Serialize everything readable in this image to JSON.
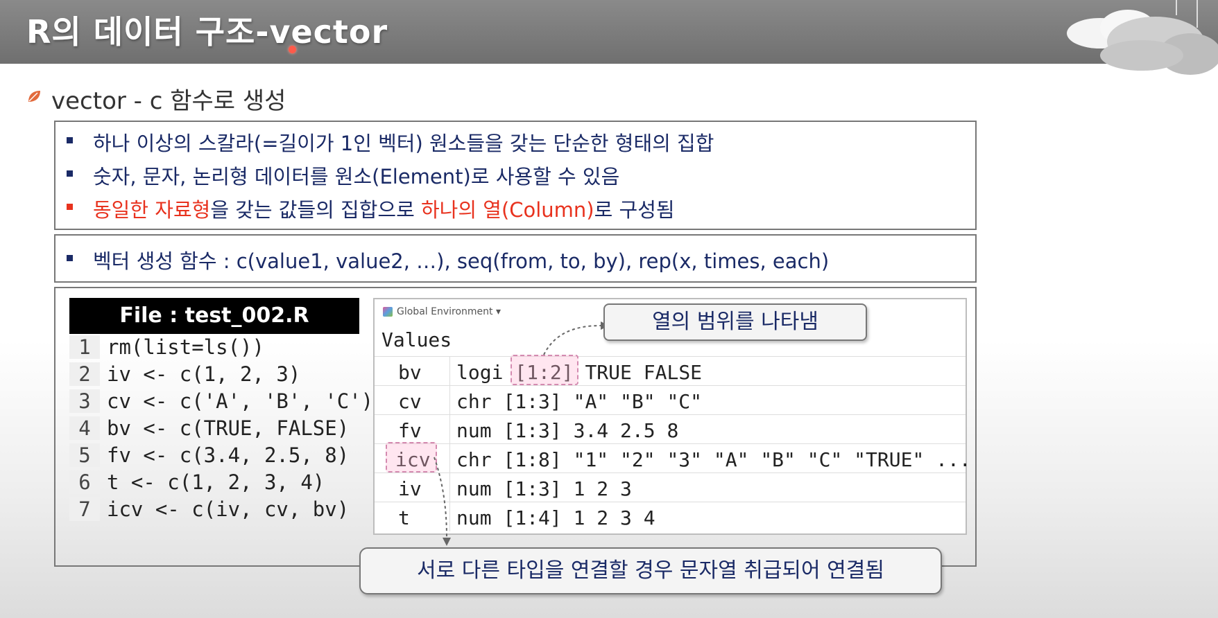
{
  "slide": {
    "title": "R의 데이터 구조-vector",
    "subtitle": "vector - c 함수로 생성"
  },
  "box1": {
    "bullets": [
      {
        "text": "하나 이상의 스칼라(=길이가 1인 벡터) 원소들을 갖는 단순한 형태의 집합"
      },
      {
        "text": "숫자, 문자, 논리형 데이터를 원소(Element)로 사용할 수 있음"
      },
      {
        "parts": [
          "동일한 자료형",
          "을 갖는 값들의 집합으로 ",
          "하나의 열(Column)",
          "로 구성됨"
        ]
      }
    ]
  },
  "box2": {
    "bullet": "벡터 생성 함수 : c(value1, value2, …), seq(from, to, by), rep(x, times, each)"
  },
  "file": {
    "header": "File : test_002.R",
    "lines": [
      {
        "n": "1",
        "code": "rm(list=ls())"
      },
      {
        "n": "2",
        "code": "iv <- c(1, 2, 3)"
      },
      {
        "n": "3",
        "code": "cv <- c('A', 'B', 'C')"
      },
      {
        "n": "4",
        "code": "bv <- c(TRUE, FALSE)"
      },
      {
        "n": "5",
        "code": "fv <- c(3.4, 2.5, 8)"
      },
      {
        "n": "6",
        "code": "t <- c(1, 2, 3, 4)"
      },
      {
        "n": "7",
        "code": "icv <- c(iv, cv, bv)"
      }
    ]
  },
  "environment": {
    "dropdown": "Global Environment",
    "section": "Values",
    "rows": [
      {
        "name": "bv",
        "type": "logi",
        "range": "[1:2]",
        "values": "TRUE FALSE"
      },
      {
        "name": "cv",
        "type": "chr",
        "range": "[1:3]",
        "values": "\"A\" \"B\" \"C\""
      },
      {
        "name": "fv",
        "type": "num",
        "range": "[1:3]",
        "values": "3.4 2.5 8"
      },
      {
        "name": "icv",
        "type": "chr",
        "range": "[1:8]",
        "values": "\"1\" \"2\" \"3\" \"A\" \"B\" \"C\" \"TRUE\" ..."
      },
      {
        "name": "iv",
        "type": "num",
        "range": "[1:3]",
        "values": "1 2 3"
      },
      {
        "name": "t",
        "type": "num",
        "range": "[1:4]",
        "values": "1 2 3 4"
      }
    ]
  },
  "callouts": {
    "range_note": "열의 범위를 나타냄",
    "coercion_note": "서로 다른 타입을 연결할 경우 문자열 취급되어 연결됨"
  },
  "colors": {
    "header_bg": "#7a7a7a",
    "bullet_text": "#1a2a66",
    "highlight_red": "#e8321e",
    "highlight_pink": "#ffb6d4"
  }
}
